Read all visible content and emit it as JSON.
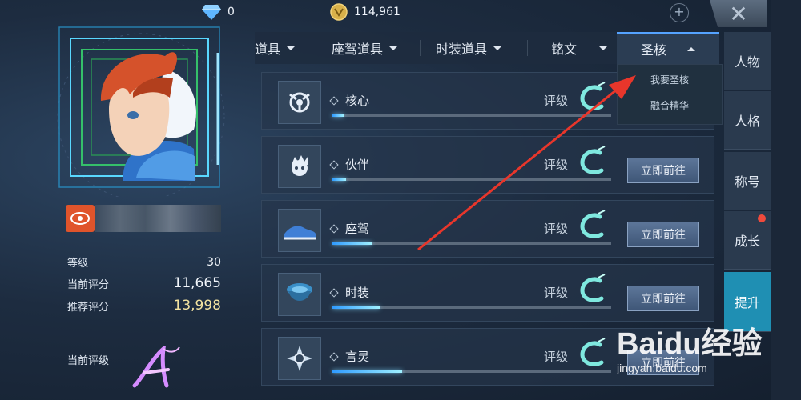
{
  "top": {
    "gems": "0",
    "coins": "114,961",
    "plus": "+"
  },
  "profile": {
    "stats": [
      {
        "label": "等级",
        "value": "30"
      },
      {
        "label": "当前评分",
        "value": "11,665"
      },
      {
        "label": "推荐评分",
        "value": "13,998"
      }
    ],
    "current_grade_label": "当前评级"
  },
  "tabs": [
    {
      "label": "道具"
    },
    {
      "label": "座驾道具"
    },
    {
      "label": "时装道具"
    },
    {
      "label": "铭文"
    },
    {
      "label": "圣核"
    }
  ],
  "dropdown": {
    "items": [
      "我要圣核",
      "融合精华"
    ]
  },
  "rows": [
    {
      "label": "核心",
      "rate_label": "评级",
      "progress": 0.04,
      "button": ""
    },
    {
      "label": "伙伴",
      "rate_label": "评级",
      "progress": 0.05,
      "button": "立即前往"
    },
    {
      "label": "座驾",
      "rate_label": "评级",
      "progress": 0.14,
      "button": "立即前往"
    },
    {
      "label": "时装",
      "rate_label": "评级",
      "progress": 0.17,
      "button": "立即前往"
    },
    {
      "label": "言灵",
      "rate_label": "评级",
      "progress": 0.25,
      "button": "立即前往"
    }
  ],
  "sidenav": [
    {
      "label": "人物"
    },
    {
      "label": "人格"
    },
    {
      "label": "称号"
    },
    {
      "label": "成长"
    },
    {
      "label": "提升"
    }
  ],
  "watermark": {
    "logo": "Baidu经验",
    "url": "jingyan.baidu.com"
  },
  "colors": {
    "accent": "#55a3ff",
    "active_nav": "#1f8fb3",
    "badge_dot": "#f04a3c",
    "arrow": "#e8362b"
  }
}
